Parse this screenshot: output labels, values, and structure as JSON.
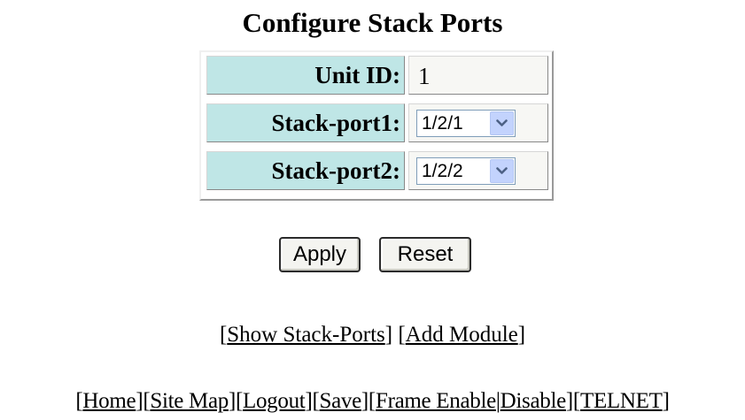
{
  "page": {
    "title": "Configure Stack Ports"
  },
  "form": {
    "unit_id_label": "Unit ID:",
    "unit_id_value": "1",
    "stack_port1_label": "Stack-port1:",
    "stack_port1_value": "1/2/1",
    "stack_port2_label": "Stack-port2:",
    "stack_port2_value": "1/2/2"
  },
  "buttons": {
    "apply": "Apply",
    "reset": "Reset"
  },
  "links": {
    "show_stack_ports": "Show Stack-Ports",
    "add_module": "Add Module"
  },
  "footer": {
    "home": "Home",
    "site_map": "Site Map",
    "logout": "Logout",
    "save": "Save",
    "frame_enable": "Frame Enable",
    "disable": "Disable",
    "telnet": "TELNET"
  },
  "colors": {
    "label_cell_bg": "#bfe6e6",
    "value_cell_bg": "#f7f7f4",
    "select_arrow_bg": "#c3d3fd",
    "select_arrow_glyph": "#4d6185"
  },
  "icons": {
    "dropdown": "chevron-down-icon"
  }
}
